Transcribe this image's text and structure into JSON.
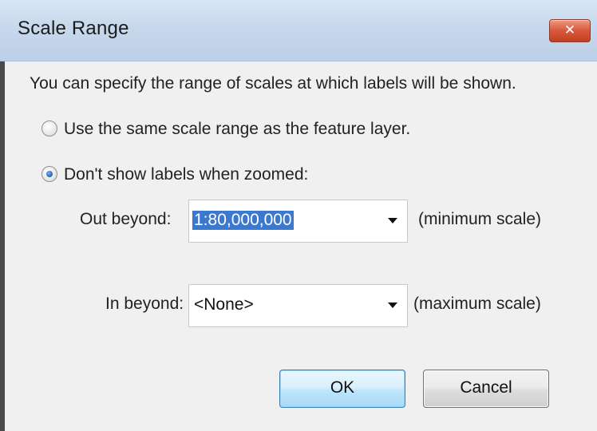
{
  "window": {
    "title": "Scale Range",
    "close_glyph": "✕"
  },
  "description": "You can specify the range of scales at which labels will be shown.",
  "options": {
    "same_scale_label": "Use the same scale range as the feature layer.",
    "same_scale_selected": false,
    "dont_show_label": "Don't show labels when zoomed:",
    "dont_show_selected": true
  },
  "out_beyond": {
    "label": "Out beyond:",
    "value": "1:80,000,000",
    "hint": "(minimum scale)"
  },
  "in_beyond": {
    "label": "In beyond:",
    "value": "<None>",
    "hint": "(maximum scale)"
  },
  "buttons": {
    "ok": "OK",
    "cancel": "Cancel"
  },
  "icons": {
    "close": "close-icon",
    "dropdown": "chevron-down-icon"
  },
  "colors": {
    "close_button": "#d9583c",
    "selection": "#3b79d0",
    "ok_border": "#3c7fb1"
  }
}
